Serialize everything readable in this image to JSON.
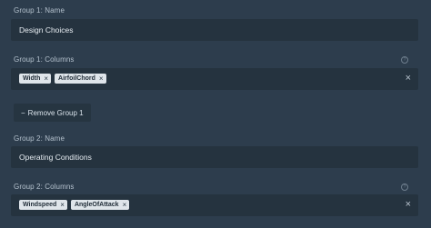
{
  "groups": [
    {
      "name_label": "Group 1: Name",
      "name_value": "Design Choices",
      "columns_label": "Group 1: Columns",
      "columns": [
        "Width",
        "AirfoilChord"
      ],
      "remove_label": "Remove Group 1",
      "remove_prefix": "−"
    },
    {
      "name_label": "Group 2: Name",
      "name_value": "Operating Conditions",
      "columns_label": "Group 2: Columns",
      "columns": [
        "Windspeed",
        "AngleOfAttack"
      ]
    }
  ],
  "icons": {
    "tag_remove": "×",
    "clear": "×",
    "help": "?"
  },
  "colors": {
    "background": "#2d3d4d",
    "field": "#25333f",
    "tag": "#dfe5ea"
  }
}
